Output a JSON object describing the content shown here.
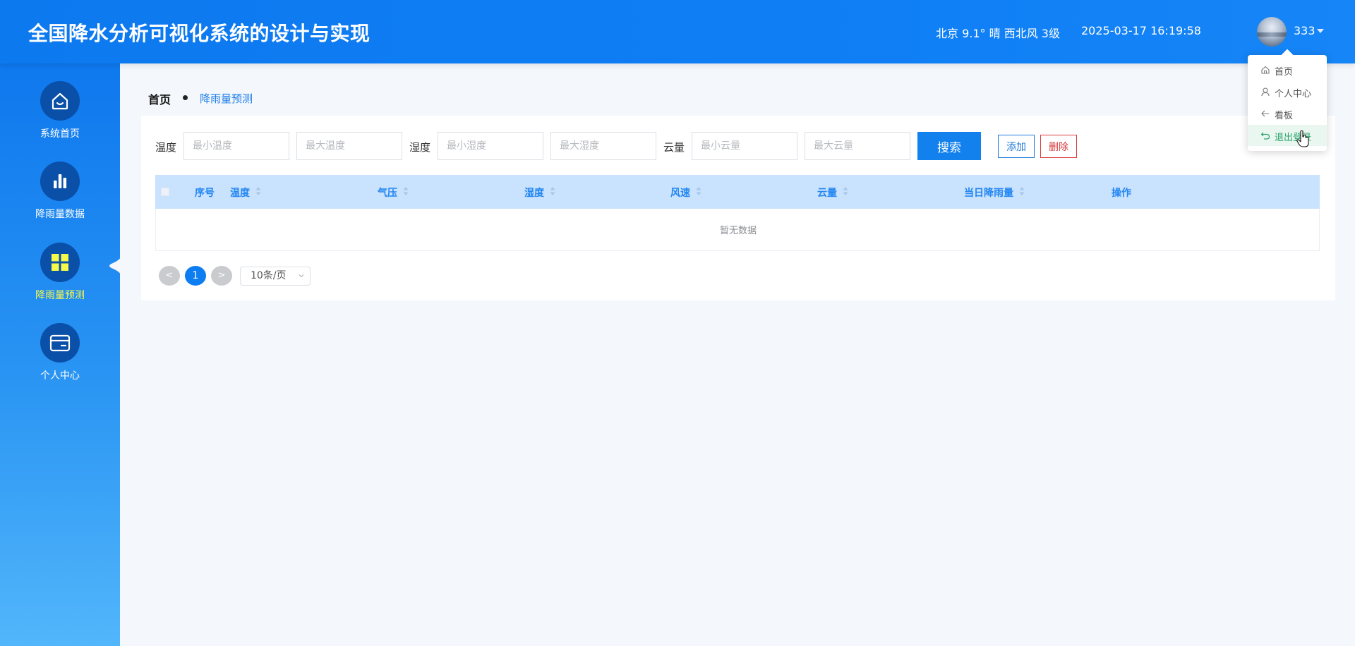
{
  "header": {
    "title": "全国降水分析可视化系统的设计与实现",
    "weather": "北京  9.1°  晴  西北风  3级",
    "datetime": "2025-03-17 16:19:58",
    "username": "333"
  },
  "sidebar": {
    "items": [
      {
        "label": "系统首页",
        "icon": "home-icon",
        "active": false
      },
      {
        "label": "降雨量数据",
        "icon": "bar-chart-icon",
        "active": false
      },
      {
        "label": "降雨量预测",
        "icon": "grid-icon",
        "active": true
      },
      {
        "label": "个人中心",
        "icon": "wallet-icon",
        "active": false
      }
    ],
    "active_label_color": "#f7f94a"
  },
  "breadcrumb": {
    "home": "首页",
    "current": "降雨量预测"
  },
  "filters": {
    "temp_label": "温度",
    "temp_min_placeholder": "最小温度",
    "temp_max_placeholder": "最大温度",
    "humidity_label": "湿度",
    "humidity_min_placeholder": "最小湿度",
    "humidity_max_placeholder": "最大湿度",
    "cloud_label": "云量",
    "cloud_min_placeholder": "最小云量",
    "cloud_max_placeholder": "最大云量",
    "search_label": "搜索",
    "add_label": "添加",
    "delete_label": "删除"
  },
  "table": {
    "columns": {
      "index": "序号",
      "temperature": "温度",
      "pressure": "气压",
      "humidity": "湿度",
      "wind": "风速",
      "cloud": "云量",
      "rainfall": "当日降雨量",
      "actions": "操作"
    },
    "empty_text": "暂无数据"
  },
  "pagination": {
    "prev": "<",
    "current_page": "1",
    "next": ">",
    "page_size": "10条/页"
  },
  "user_menu": {
    "items": [
      {
        "label": "首页",
        "icon": "home-outline-icon"
      },
      {
        "label": "个人中心",
        "icon": "user-icon"
      },
      {
        "label": "看板",
        "icon": "arrow-left-icon"
      },
      {
        "label": "退出登录",
        "icon": "logout-icon"
      }
    ],
    "hover_color": "#2ba36a"
  },
  "colors": {
    "header_bg": "#0f7ef5",
    "primary": "#1281ee",
    "danger": "#d9383a",
    "table_header_bg": "#c9e2fd"
  }
}
